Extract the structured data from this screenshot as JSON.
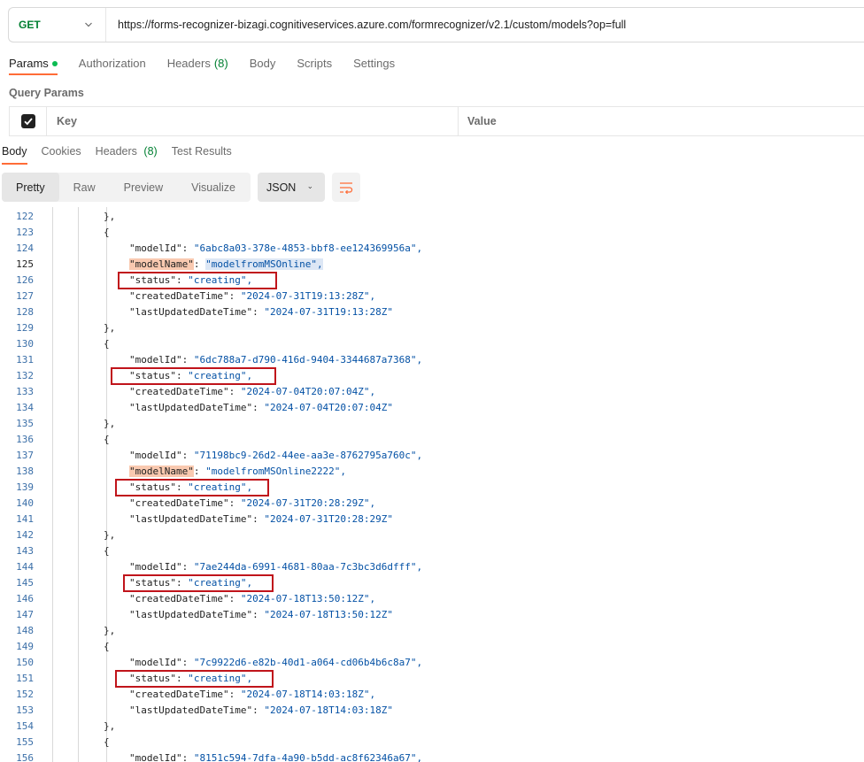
{
  "request": {
    "method": "GET",
    "url": "https://forms-recognizer-bizagi.cognitiveservices.azure.com/formrecognizer/v2.1/custom/models?op=full"
  },
  "request_tabs": {
    "params": "Params",
    "authorization": "Authorization",
    "headers": "Headers",
    "headers_count": "(8)",
    "body": "Body",
    "scripts": "Scripts",
    "settings": "Settings"
  },
  "query_params": {
    "title": "Query Params",
    "key_header": "Key",
    "value_header": "Value"
  },
  "response_tabs": {
    "body": "Body",
    "cookies": "Cookies",
    "headers": "Headers",
    "headers_count": "(8)",
    "test_results": "Test Results"
  },
  "view": {
    "pretty": "Pretty",
    "raw": "Raw",
    "preview": "Preview",
    "visualize": "Visualize",
    "format": "JSON"
  },
  "colors": {
    "accent": "#ff6c37",
    "method_get": "#007f31",
    "string_value": "#0451a5",
    "annotation_box": "#c0141b"
  },
  "code_lines": [
    {
      "n": "122",
      "text": "},"
    },
    {
      "n": "123",
      "text": "{"
    },
    {
      "n": "124",
      "k": "\"modelId\"",
      "v": "\"6abc8a03-378e-4853-bbf8-ee124369956a\","
    },
    {
      "n": "125",
      "k": "\"modelName\"",
      "v": "\"modelfromMSOnline\","
    },
    {
      "n": "126",
      "k": "\"status\"",
      "v": "\"creating\","
    },
    {
      "n": "127",
      "k": "\"createdDateTime\"",
      "v": "\"2024-07-31T19:13:28Z\","
    },
    {
      "n": "128",
      "k": "\"lastUpdatedDateTime\"",
      "v": "\"2024-07-31T19:13:28Z\""
    },
    {
      "n": "129",
      "text": "},"
    },
    {
      "n": "130",
      "text": "{"
    },
    {
      "n": "131",
      "k": "\"modelId\"",
      "v": "\"6dc788a7-d790-416d-9404-3344687a7368\","
    },
    {
      "n": "132",
      "k": "\"status\"",
      "v": "\"creating\","
    },
    {
      "n": "133",
      "k": "\"createdDateTime\"",
      "v": "\"2024-07-04T20:07:04Z\","
    },
    {
      "n": "134",
      "k": "\"lastUpdatedDateTime\"",
      "v": "\"2024-07-04T20:07:04Z\""
    },
    {
      "n": "135",
      "text": "},"
    },
    {
      "n": "136",
      "text": "{"
    },
    {
      "n": "137",
      "k": "\"modelId\"",
      "v": "\"71198bc9-26d2-44ee-aa3e-8762795a760c\","
    },
    {
      "n": "138",
      "k": "\"modelName\"",
      "v": "\"modelfromMSOnline2222\","
    },
    {
      "n": "139",
      "k": "\"status\"",
      "v": "\"creating\","
    },
    {
      "n": "140",
      "k": "\"createdDateTime\"",
      "v": "\"2024-07-31T20:28:29Z\","
    },
    {
      "n": "141",
      "k": "\"lastUpdatedDateTime\"",
      "v": "\"2024-07-31T20:28:29Z\""
    },
    {
      "n": "142",
      "text": "},"
    },
    {
      "n": "143",
      "text": "{"
    },
    {
      "n": "144",
      "k": "\"modelId\"",
      "v": "\"7ae244da-6991-4681-80aa-7c3bc3d6dfff\","
    },
    {
      "n": "145",
      "k": "\"status\"",
      "v": "\"creating\","
    },
    {
      "n": "146",
      "k": "\"createdDateTime\"",
      "v": "\"2024-07-18T13:50:12Z\","
    },
    {
      "n": "147",
      "k": "\"lastUpdatedDateTime\"",
      "v": "\"2024-07-18T13:50:12Z\""
    },
    {
      "n": "148",
      "text": "},"
    },
    {
      "n": "149",
      "text": "{"
    },
    {
      "n": "150",
      "k": "\"modelId\"",
      "v": "\"7c9922d6-e82b-40d1-a064-cd06b4b6c8a7\","
    },
    {
      "n": "151",
      "k": "\"status\"",
      "v": "\"creating\","
    },
    {
      "n": "152",
      "k": "\"createdDateTime\"",
      "v": "\"2024-07-18T14:03:18Z\","
    },
    {
      "n": "153",
      "k": "\"lastUpdatedDateTime\"",
      "v": "\"2024-07-18T14:03:18Z\""
    },
    {
      "n": "154",
      "text": "},"
    },
    {
      "n": "155",
      "text": "{"
    },
    {
      "n": "156",
      "k": "\"modelId\"",
      "v": "\"8151c594-7dfa-4a90-b5dd-ac8f62346a67\","
    }
  ]
}
